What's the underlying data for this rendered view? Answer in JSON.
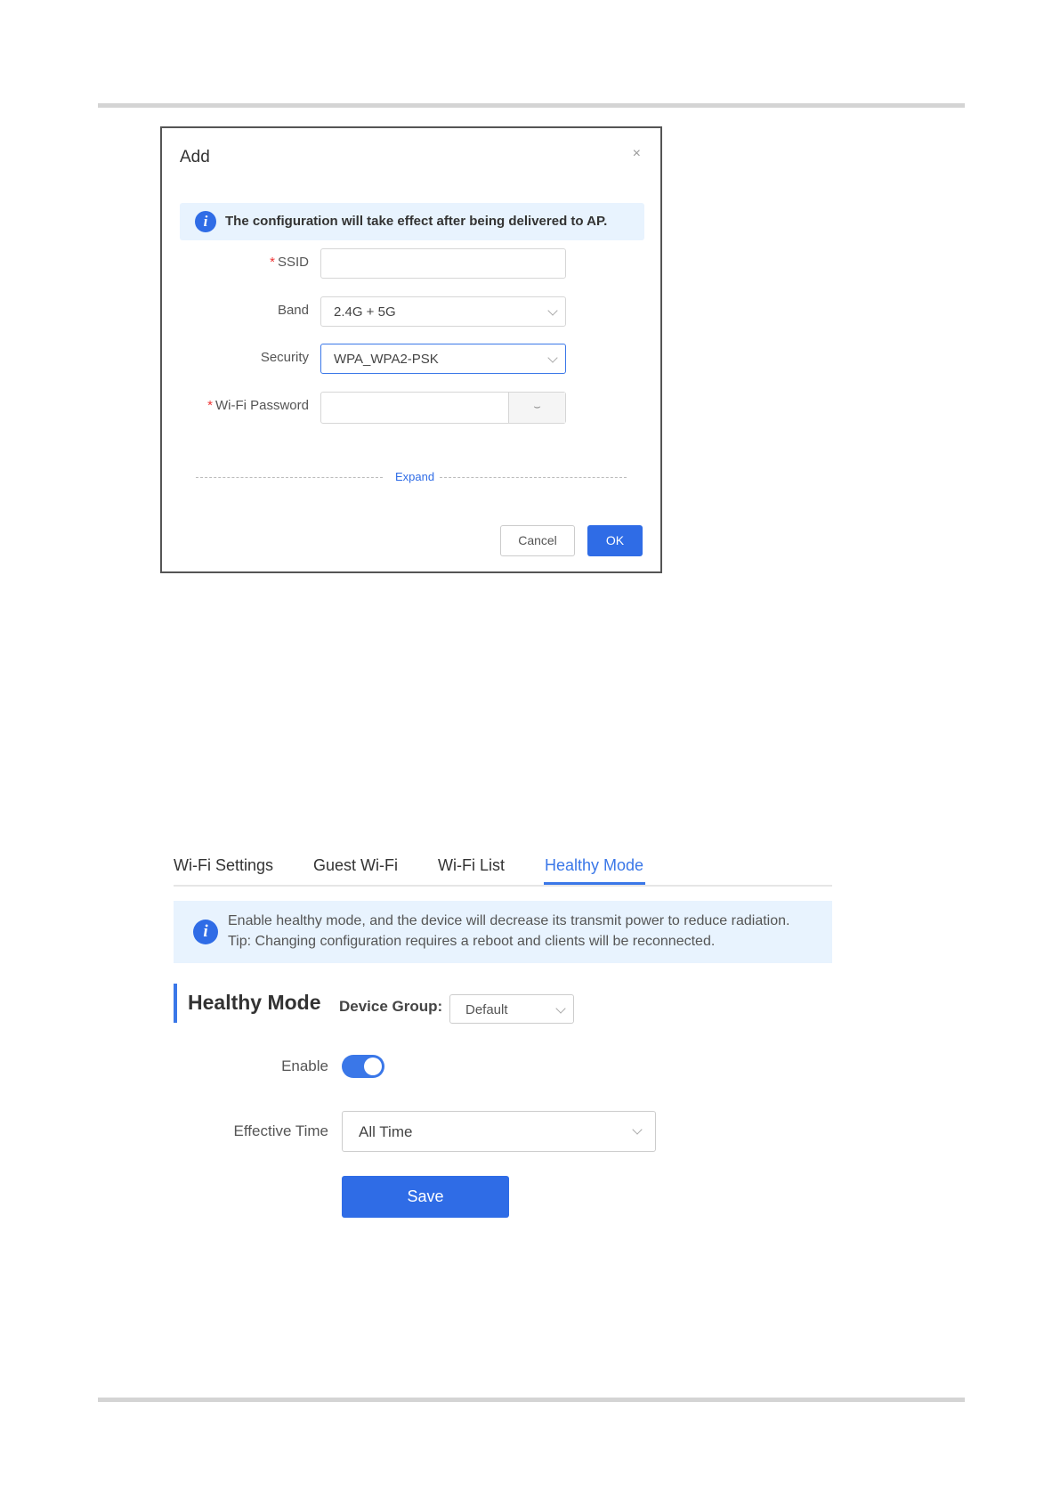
{
  "dialog": {
    "title": "Add",
    "close_symbol": "×",
    "notice": "The configuration will take effect after being delivered to AP.",
    "info_glyph": "i",
    "fields": {
      "ssid": {
        "label": "SSID",
        "required_mark": "*",
        "value": ""
      },
      "band": {
        "label": "Band",
        "value": "2.4G + 5G"
      },
      "security": {
        "label": "Security",
        "value": "WPA_WPA2-PSK"
      },
      "wifi_password": {
        "label": "Wi-Fi Password",
        "required_mark": "*",
        "value": "",
        "eye_glyph": "⌣"
      }
    },
    "expand_label": "Expand",
    "cancel_label": "Cancel",
    "ok_label": "OK"
  },
  "healthy_mode_page": {
    "tabs": [
      {
        "label": "Wi-Fi Settings",
        "active": false
      },
      {
        "label": "Guest Wi-Fi",
        "active": false
      },
      {
        "label": "Wi-Fi List",
        "active": false
      },
      {
        "label": "Healthy Mode",
        "active": true
      }
    ],
    "notice_lines": [
      "Enable healthy mode, and the device will decrease its transmit power to reduce radiation.",
      "Tip: Changing configuration requires a reboot and clients will be reconnected."
    ],
    "info_glyph": "i",
    "section_title": "Healthy Mode",
    "device_group": {
      "label": "Device Group:",
      "value": "Default"
    },
    "enable": {
      "label": "Enable",
      "on": true
    },
    "effective_time": {
      "label": "Effective Time",
      "value": "All Time"
    },
    "save_label": "Save"
  },
  "colors": {
    "accent": "#2f6ce6",
    "notice_bg": "#e8f3fe",
    "required": "#e33333"
  }
}
